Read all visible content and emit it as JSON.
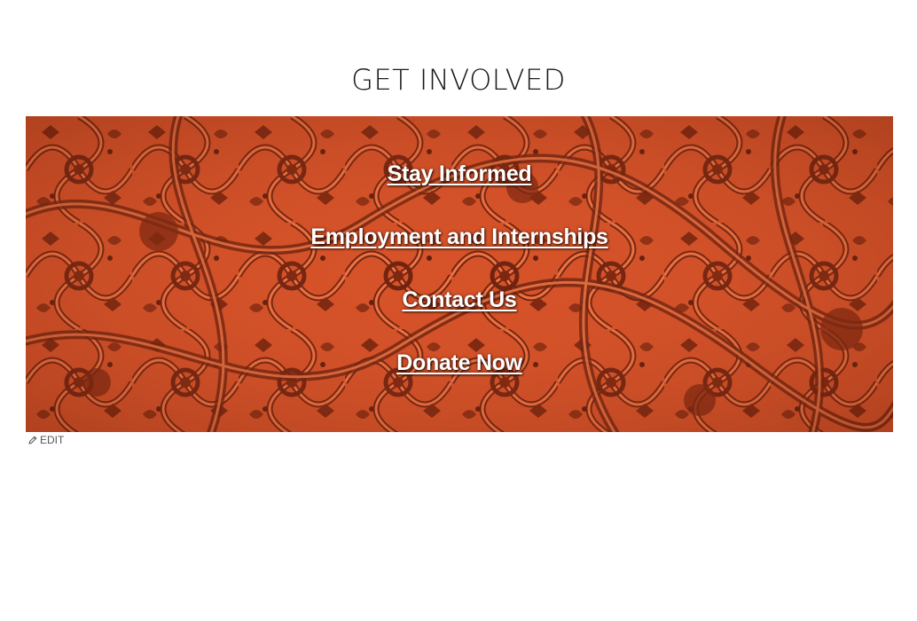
{
  "section": {
    "title": "GET INVOLVED"
  },
  "banner": {
    "background_color": "#d8552a",
    "pattern_color": "#7a2610",
    "links": [
      {
        "label": "Stay Informed"
      },
      {
        "label": "Employment and Internships"
      },
      {
        "label": "Contact Us"
      },
      {
        "label": "Donate Now"
      }
    ]
  },
  "edit": {
    "label": "EDIT",
    "icon": "pencil-icon"
  }
}
